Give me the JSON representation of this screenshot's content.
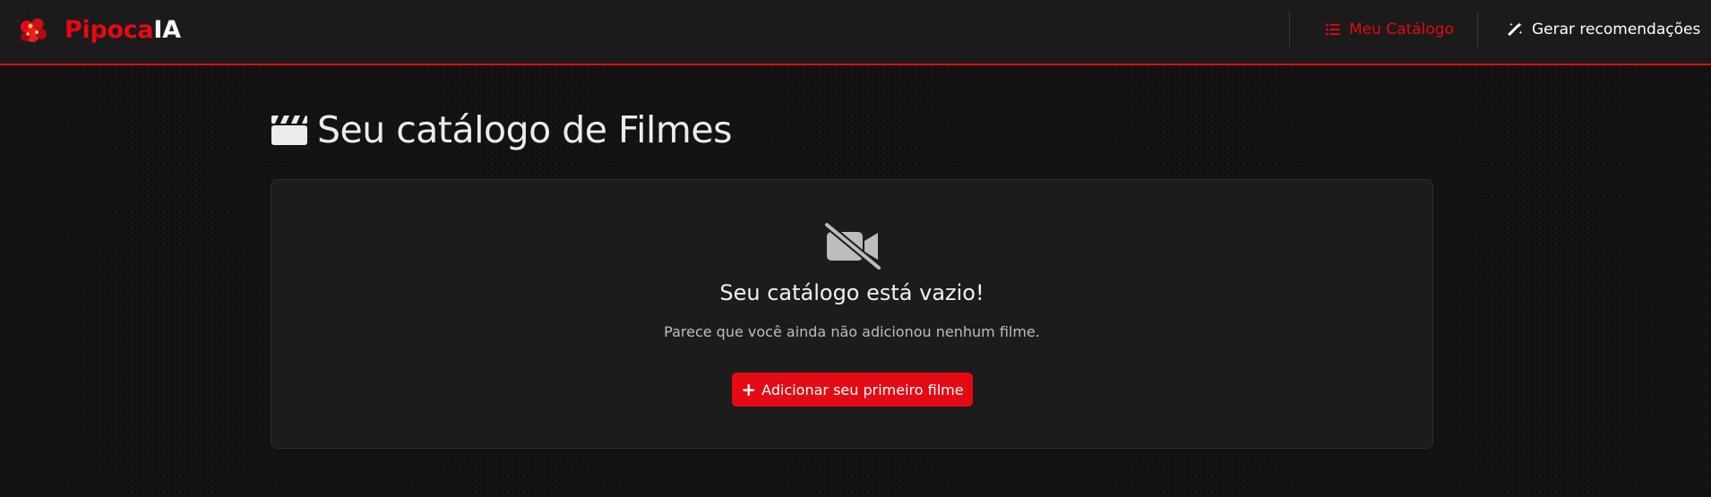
{
  "brand": {
    "name_red": "Pipoca",
    "name_white": "IA",
    "logo_icon": "popcorn-logo-icon"
  },
  "nav": {
    "items": [
      {
        "label": "Meu Catálogo",
        "icon": "list-icon",
        "active": true
      },
      {
        "label": "Gerar recomendações",
        "icon": "magic-wand-icon",
        "active": false
      }
    ]
  },
  "page": {
    "title": "Seu catálogo de Filmes",
    "title_icon": "clapperboard-icon"
  },
  "empty_state": {
    "icon": "video-slash-icon",
    "title": "Seu catálogo está vazio!",
    "description": "Parece que você ainda não adicionou nenhum filme.",
    "button_label": "Adicionar seu primeiro filme",
    "button_icon": "plus-icon"
  },
  "colors": {
    "accent": "#e50914",
    "background": "#121212",
    "navbar": "#1b1b1b",
    "card": "#1c1c1c"
  }
}
